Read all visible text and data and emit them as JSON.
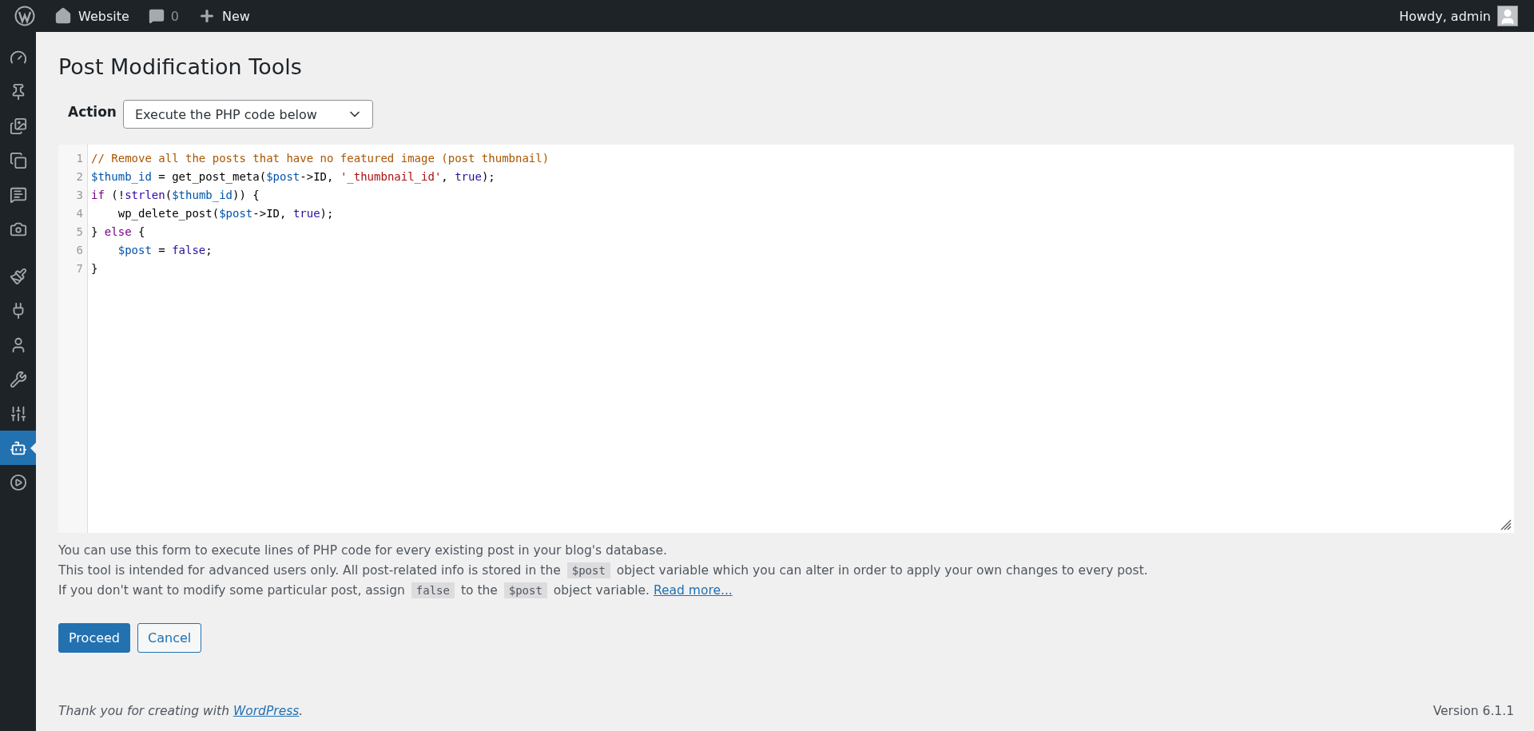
{
  "admin_bar": {
    "site_name": "Website",
    "comments_count": "0",
    "new_label": "New",
    "greeting": "Howdy, admin"
  },
  "sidebar": {
    "groups": [
      [
        {
          "selected": false
        },
        {
          "selected": false
        },
        {
          "selected": false
        },
        {
          "selected": false
        },
        {
          "selected": false
        },
        {
          "selected": false
        }
      ],
      [
        {
          "selected": false
        },
        {
          "selected": false
        },
        {
          "selected": false
        },
        {
          "selected": false
        },
        {
          "selected": false
        },
        {
          "selected": true
        },
        {
          "selected": false
        }
      ]
    ]
  },
  "page": {
    "title": "Post Modification Tools",
    "action_label": "Action",
    "action_value": "Execute the PHP code below"
  },
  "editor": {
    "lines": [
      [
        {
          "kind": "comment",
          "text": "// Remove all the posts that have no featured image (post thumbnail)"
        }
      ],
      [
        {
          "kind": "variable",
          "text": "$thumb_id"
        },
        {
          "kind": "plain",
          "text": " = get_post_meta("
        },
        {
          "kind": "variable",
          "text": "$post"
        },
        {
          "kind": "plain",
          "text": "->ID, "
        },
        {
          "kind": "string",
          "text": "'_thumbnail_id'"
        },
        {
          "kind": "plain",
          "text": ", "
        },
        {
          "kind": "atom",
          "text": "true"
        },
        {
          "kind": "plain",
          "text": ");"
        }
      ],
      [
        {
          "kind": "keyword",
          "text": "if"
        },
        {
          "kind": "plain",
          "text": " (!"
        },
        {
          "kind": "builtin",
          "text": "strlen"
        },
        {
          "kind": "plain",
          "text": "("
        },
        {
          "kind": "variable",
          "text": "$thumb_id"
        },
        {
          "kind": "plain",
          "text": ")) {"
        }
      ],
      [
        {
          "kind": "plain",
          "text": "    wp_delete_post("
        },
        {
          "kind": "variable",
          "text": "$post"
        },
        {
          "kind": "plain",
          "text": "->ID, "
        },
        {
          "kind": "atom",
          "text": "true"
        },
        {
          "kind": "plain",
          "text": ");"
        }
      ],
      [
        {
          "kind": "plain",
          "text": "} "
        },
        {
          "kind": "keyword",
          "text": "else"
        },
        {
          "kind": "plain",
          "text": " {"
        }
      ],
      [
        {
          "kind": "variable",
          "text": "    $post"
        },
        {
          "kind": "plain",
          "text": " = "
        },
        {
          "kind": "atom",
          "text": "false"
        },
        {
          "kind": "plain",
          "text": ";"
        }
      ],
      [
        {
          "kind": "plain",
          "text": "}"
        }
      ]
    ],
    "line_numbers": [
      "1",
      "2",
      "3",
      "4",
      "5",
      "6",
      "7"
    ]
  },
  "help": [
    [
      {
        "kind": "text",
        "text": "You can use this form to execute lines of PHP code for every existing post in your blog's database."
      }
    ],
    [
      {
        "kind": "text",
        "text": "This tool is intended for advanced users only. All post-related info is stored in the "
      },
      {
        "kind": "code",
        "text": "$post"
      },
      {
        "kind": "text",
        "text": " object variable which you can alter in order to apply your own changes to every post."
      }
    ],
    [
      {
        "kind": "text",
        "text": "If you don't want to modify some particular post, assign "
      },
      {
        "kind": "code",
        "text": "false"
      },
      {
        "kind": "text",
        "text": " to the "
      },
      {
        "kind": "code",
        "text": "$post"
      },
      {
        "kind": "text",
        "text": " object variable. "
      },
      {
        "kind": "link",
        "text": "Read more..."
      }
    ]
  ],
  "buttons": {
    "primary": "Proceed",
    "secondary": "Cancel"
  },
  "footer": {
    "thanks_text": "Thank you for creating with ",
    "thanks_link": "WordPress",
    "thanks_end": ".",
    "version": "Version 6.1.1"
  }
}
